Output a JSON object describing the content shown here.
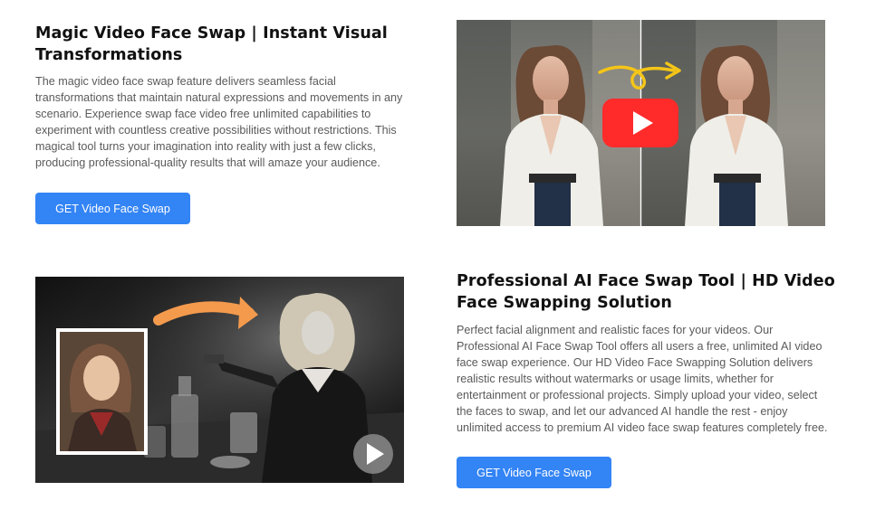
{
  "section1": {
    "title": "Magic Video Face Swap | Instant Visual Transformations",
    "description": "The magic video face swap feature delivers seamless facial transformations that maintain natural expressions and movements in any scenario. Experience swap face video free unlimited capabilities to experiment with countless creative possibilities without restrictions. This magical tool turns your imagination into reality with just a few clicks, producing professional-quality results that will amaze your audience.",
    "button_label": "GET Video Face Swap",
    "media": {
      "icons": [
        "play-button-icon",
        "arrow-icon"
      ],
      "colors": {
        "play_badge": "#ff2b2b",
        "arrow": "#f5c518"
      }
    }
  },
  "section2": {
    "title": "Professional AI Face Swap Tool | HD Video Face Swapping Solution",
    "description": "Perfect facial alignment and realistic faces for your videos. Our Professional AI Face Swap Tool offers all users a free, unlimited AI video face swap experience. Our HD Video Face Swapping Solution delivers realistic results without watermarks or usage limits, whether for entertainment or professional projects. Simply upload your video, select the faces to swap, and let our advanced AI handle the rest - enjoy unlimited access to premium AI video face swap features completely free.",
    "button_label": "GET Video Face Swap",
    "media": {
      "icons": [
        "play-button-icon",
        "arrow-icon"
      ],
      "colors": {
        "arrow": "#f39a4d"
      }
    }
  },
  "theme": {
    "button_bg": "#3384f5",
    "title_color": "#111111",
    "text_color": "#5a5a5a"
  }
}
